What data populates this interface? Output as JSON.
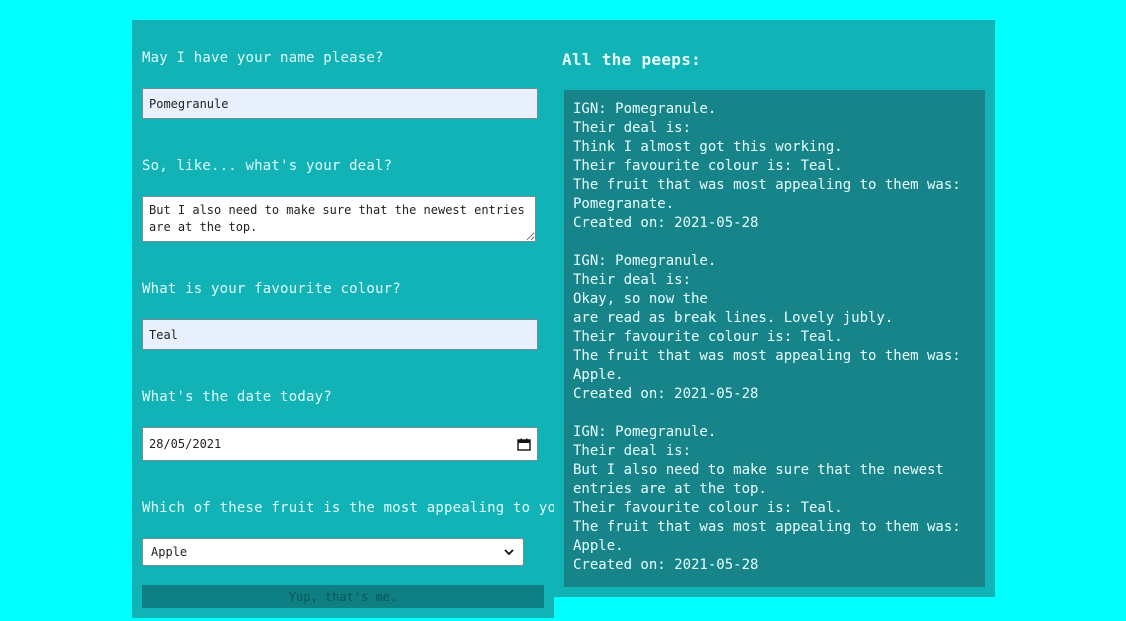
{
  "form": {
    "name_question": "May I have your name please?",
    "name_value": "Pomegranule",
    "deal_question": "So, like... what's your deal?",
    "deal_value": "But I also need to make sure that the newest entries are at the top.",
    "colour_question": "What is your favourite colour?",
    "colour_value": "Teal",
    "date_question": "What's the date today?",
    "date_value": "28/05/2021",
    "fruit_question": "Which of these fruit is the most appealing to you?",
    "fruit_value": "Apple",
    "submit_label": "Yup, that's me."
  },
  "list": {
    "title": "All the peeps:",
    "entries": [
      {
        "ign": "IGN: Pomegranule.",
        "deal_label": "Their deal is:",
        "deal": "Think I almost got this working.",
        "colour": "Their favourite colour is: Teal.",
        "fruit_label": "The fruit that was most appealing to them was:",
        "fruit": "Pomegranate.",
        "created": "Created on: 2021-05-28"
      },
      {
        "ign": "IGN: Pomegranule.",
        "deal_label": "Their deal is:",
        "deal": "Okay, so now the\nare read as break lines. Lovely jubly.",
        "colour": "Their favourite colour is: Teal.",
        "fruit_label": "The fruit that was most appealing to them was:",
        "fruit": "Apple.",
        "created": "Created on: 2021-05-28"
      },
      {
        "ign": "IGN: Pomegranule.",
        "deal_label": "Their deal is:",
        "deal": "But I also need to make sure that the newest entries are at the top.",
        "colour": "Their favourite colour is: Teal.",
        "fruit_label": "The fruit that was most appealing to them was:",
        "fruit": "Apple.",
        "created": "Created on: 2021-05-28"
      }
    ]
  },
  "icons": {
    "date_picker": "calendar-icon",
    "select_arrow": "chevron-down-icon"
  },
  "colors": {
    "page_background": "#00ffff",
    "panel_background": "#12b3b6",
    "list_box_background": "#168489",
    "submit_background": "#0e7f82"
  }
}
